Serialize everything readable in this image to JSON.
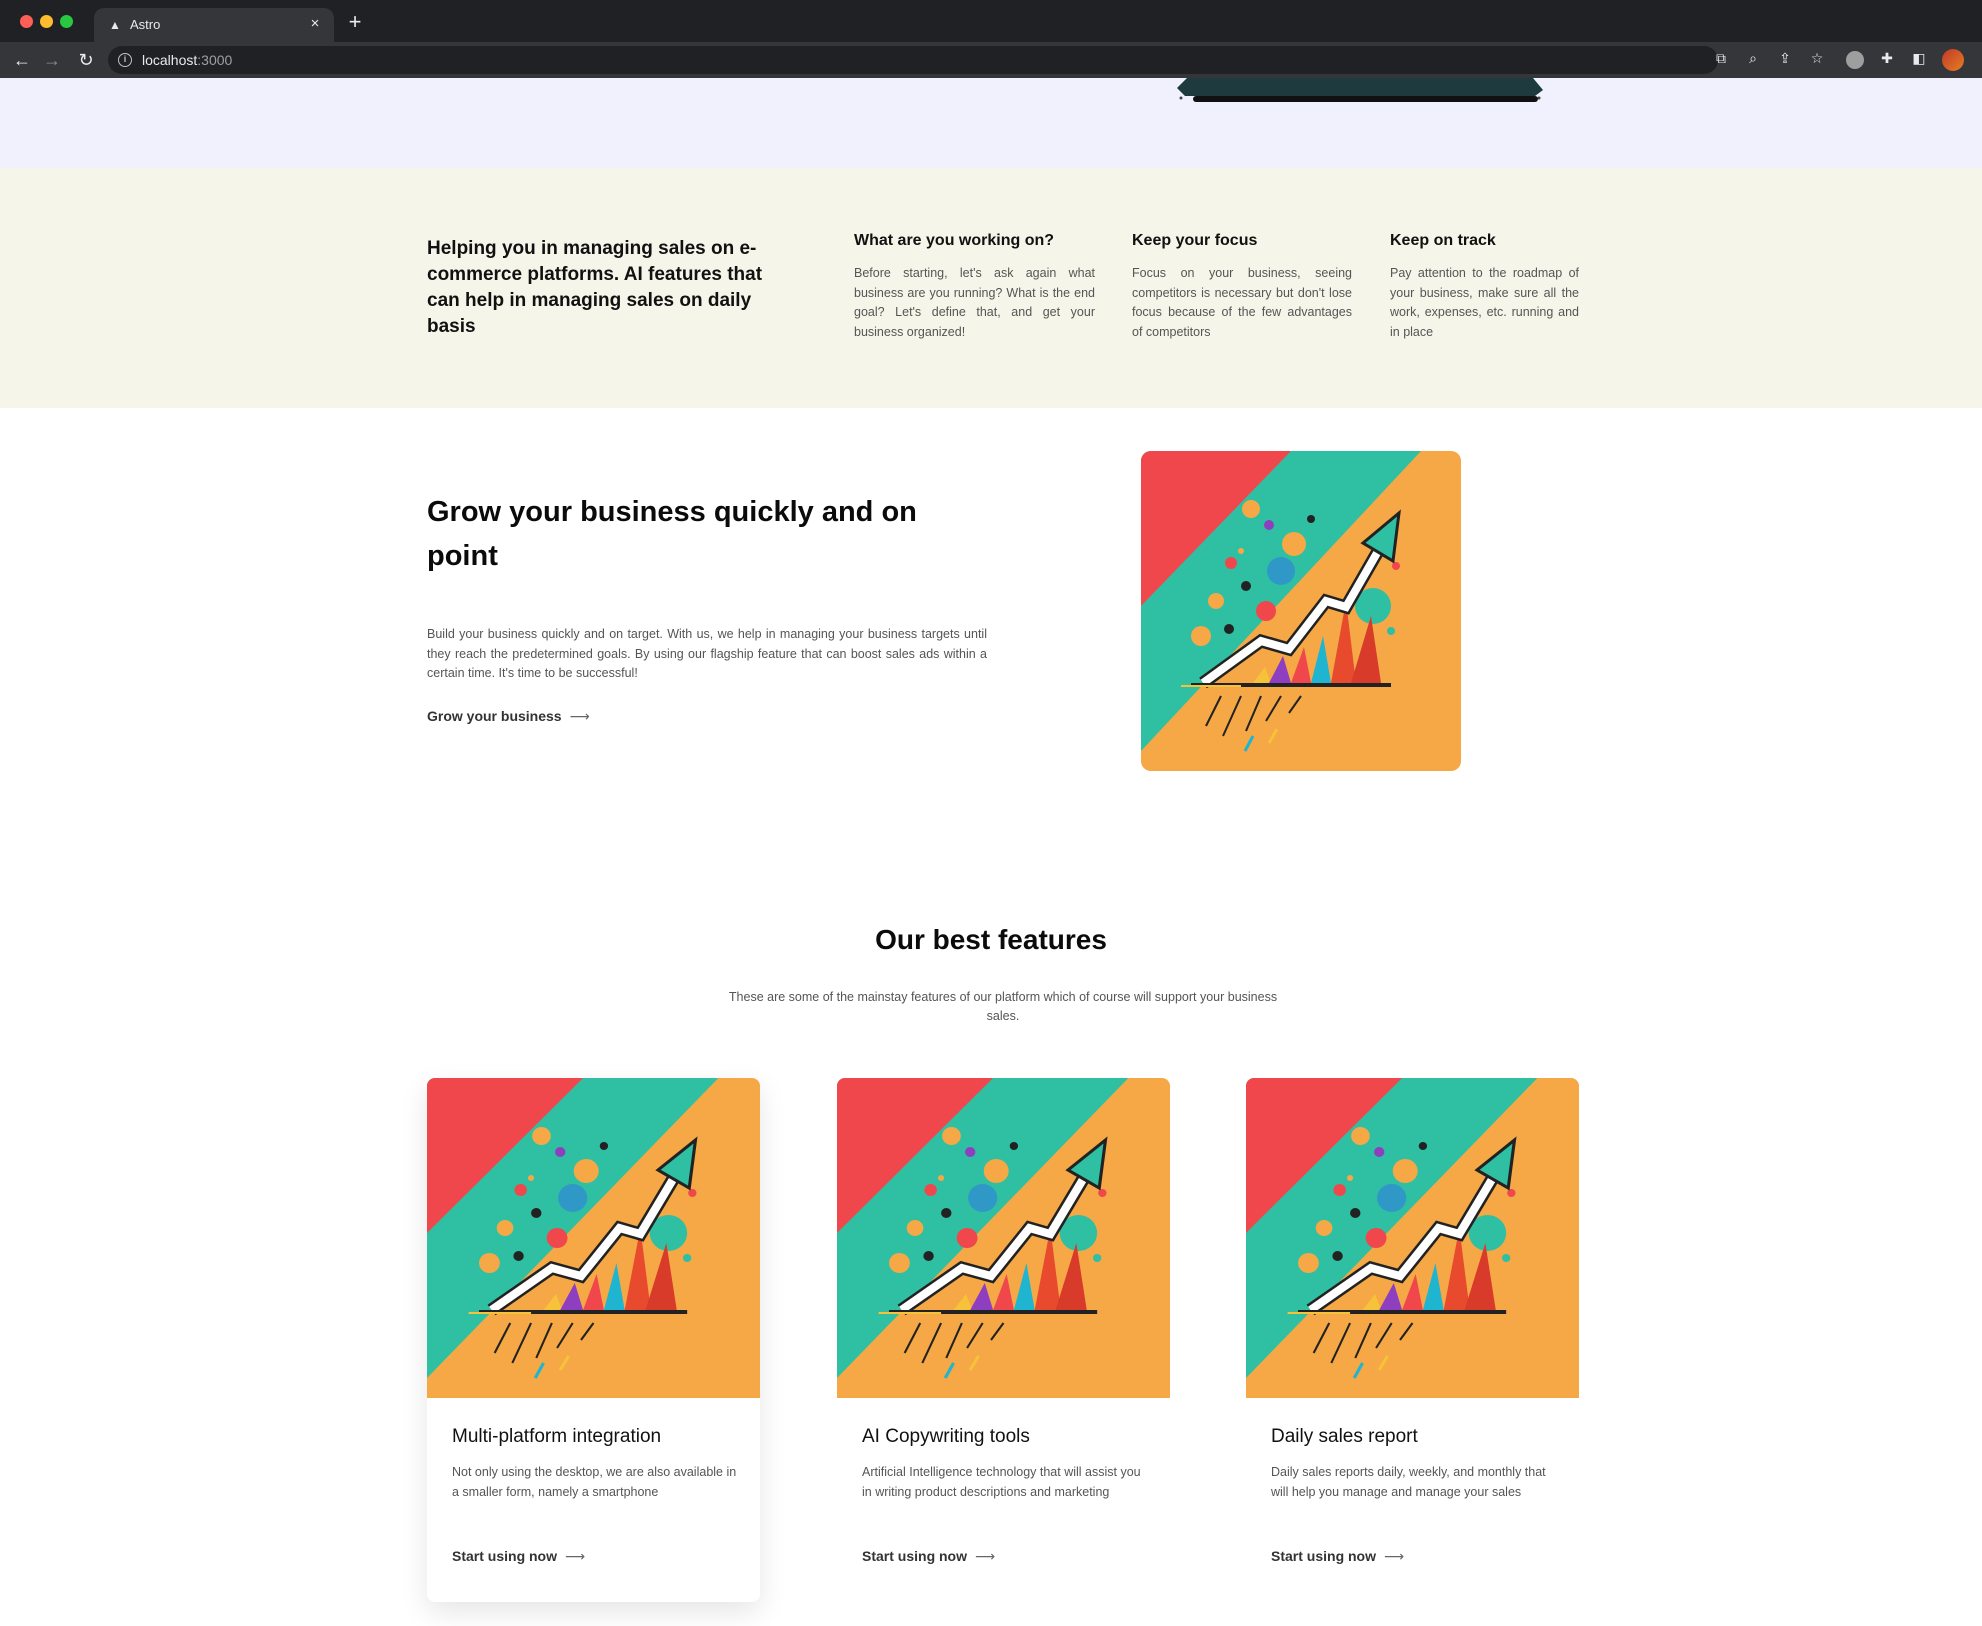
{
  "browser": {
    "tab_title": "Astro",
    "url_host": "localhost",
    "url_port": ":3000"
  },
  "info": {
    "lead": "Helping you in managing sales on e-commerce platforms. AI features that can help in managing sales on daily basis",
    "columns": [
      {
        "title": "What are you working on?",
        "text": "Before starting, let's ask again what business are you running? What is the end goal? Let's define that, and get your business organized!"
      },
      {
        "title": "Keep your focus",
        "text": "Focus on your business, seeing competitors is necessary but don't lose focus because of the few advantages of competitors"
      },
      {
        "title": "Keep on track",
        "text": "Pay attention to the roadmap of your business, make sure all the work, expenses, etc. running and in place"
      }
    ]
  },
  "grow": {
    "title": "Grow your business quickly and on point",
    "body": "Build your business quickly and on target. With us, we help in managing your business targets until they reach the predetermined goals. By using our flagship feature that can boost sales ads within a certain time. It's time to be successful!",
    "link": "Grow your business",
    "arrow": "⟶"
  },
  "features": {
    "title": "Our best features",
    "subtitle": "These are some of the mainstay features of our platform which of course will support your business sales.",
    "cards": [
      {
        "title": "Multi-platform integration",
        "text": "Not only using the desktop, we are also available in a smaller form, namely a smartphone",
        "cta": "Start using now"
      },
      {
        "title": "AI Copywriting tools",
        "text": "Artificial Intelligence technology that will assist you in writing product descriptions and marketing",
        "cta": "Start using now"
      },
      {
        "title": "Daily sales report",
        "text": "Daily sales reports daily, weekly, and monthly that will help you manage and manage your sales",
        "cta": "Start using now"
      }
    ]
  },
  "colors": {
    "hero_bg": "#f1f0fd",
    "info_bg": "#f6f5e9",
    "art_red": "#f0474d",
    "art_teal": "#2fbfa3",
    "art_orange": "#f5a845"
  },
  "icons": {
    "tab": "astro-logo-icon",
    "close": "close-icon",
    "new_tab": "plus-icon",
    "back": "arrow-left-icon",
    "forward": "arrow-right-icon",
    "reload": "reload-icon",
    "site_info": "info-icon",
    "translate": "translate-icon",
    "zoom": "zoom-icon",
    "share": "share-icon",
    "bookmark": "star-icon",
    "extensions": "puzzle-icon",
    "sidebar": "sidebar-icon",
    "link_arrow": "arrow-right-icon"
  }
}
